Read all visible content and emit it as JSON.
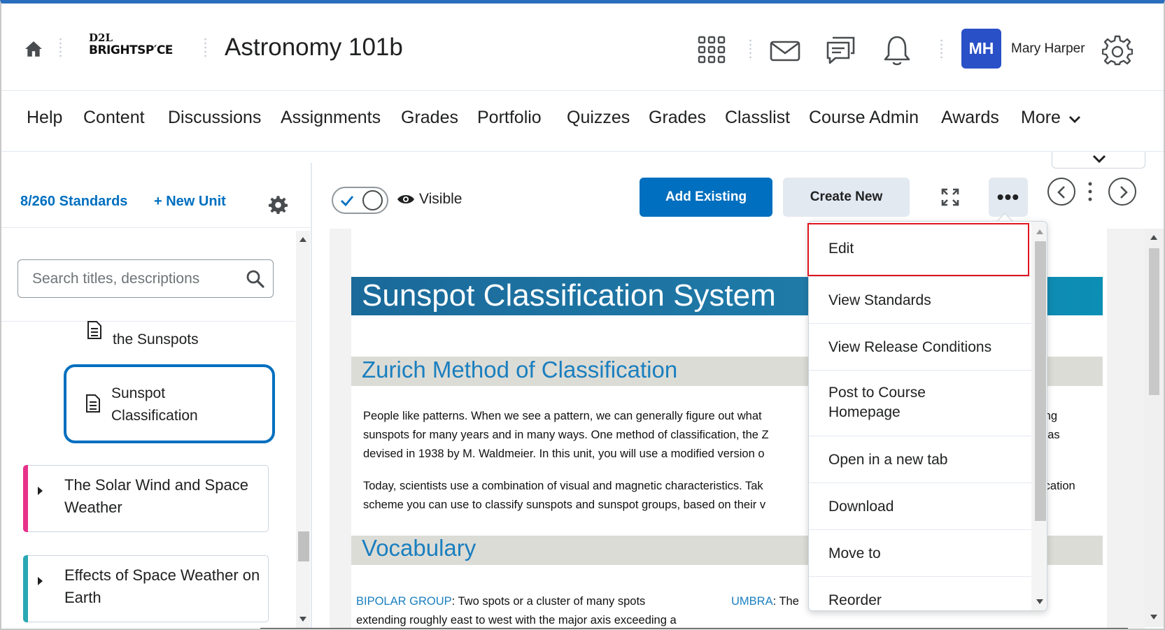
{
  "header": {
    "logo_top": "D2L",
    "logo_bottom": "BRIGHTSP′CE",
    "course_title": "Astronomy 101b",
    "user_initials": "MH",
    "user_name": "Mary Harper"
  },
  "nav": {
    "items": [
      "Help",
      "Content",
      "Discussions",
      "Assignments",
      "Grades",
      "Portfolio",
      "Quizzes",
      "Grades",
      "Classlist",
      "Course Admin",
      "Awards",
      "More"
    ]
  },
  "left_panel": {
    "standards_link": "8/260 Standards",
    "new_unit_link": "+ New Unit",
    "search_placeholder": "Search titles, descriptions",
    "tree": {
      "partial_item": "the Sunspots",
      "selected_item_line1": "Sunspot",
      "selected_item_line2": "Classification",
      "units": [
        {
          "line1": "The Solar Wind and Space",
          "line2": "Weather",
          "color": "#e7318b"
        },
        {
          "line1": "Effects of Space Weather on",
          "line2": "Earth",
          "color": "#29a8b3"
        }
      ]
    }
  },
  "toolbar": {
    "visible_label": "Visible",
    "add_existing": "Add Existing",
    "create_new": "Create New",
    "more": "•••"
  },
  "document": {
    "title": "Sunspot Classification System",
    "section1_title": "Zurich Method of Classification",
    "para1": [
      "People like patterns. When we see a pattern, we can generally figure out what",
      "sunspots for many years and in many ways. One method of classification, the Z",
      "devised in 1938 by M. Waldmeier. In this unit, you will use a modified version o"
    ],
    "para1_right": [
      "ing",
      "vas"
    ],
    "para2": [
      "Today, scientists use a combination of visual and magnetic characteristics. Tak",
      "scheme you can use to classify sunspots and sunspot groups, based on their v"
    ],
    "para2_right": "ication",
    "section2_title": "Vocabulary",
    "vocab_term1": "BIPOLAR  GROUP",
    "vocab_def1_line1": ": Two spots or a cluster of many spots",
    "vocab_def1_line2": "extending roughly east to west with the major axis exceeding a",
    "vocab_term2": "UMBRA",
    "vocab_def2": ": The"
  },
  "menu": {
    "items": [
      [
        "Edit"
      ],
      [
        "View Standards"
      ],
      [
        "View Release Conditions"
      ],
      [
        "Post to Course",
        "Homepage"
      ],
      [
        "Open in a new tab"
      ],
      [
        "Download"
      ],
      [
        "Move to"
      ],
      [
        "Reorder"
      ]
    ]
  }
}
